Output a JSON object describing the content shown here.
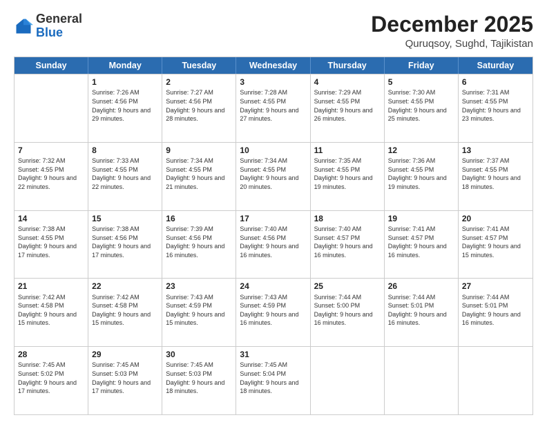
{
  "logo": {
    "general": "General",
    "blue": "Blue"
  },
  "title": "December 2025",
  "location": "Quruqsoy, Sughd, Tajikistan",
  "weekdays": [
    "Sunday",
    "Monday",
    "Tuesday",
    "Wednesday",
    "Thursday",
    "Friday",
    "Saturday"
  ],
  "rows": [
    [
      {
        "day": "",
        "sunrise": "",
        "sunset": "",
        "daylight": ""
      },
      {
        "day": "1",
        "sunrise": "Sunrise: 7:26 AM",
        "sunset": "Sunset: 4:56 PM",
        "daylight": "Daylight: 9 hours and 29 minutes."
      },
      {
        "day": "2",
        "sunrise": "Sunrise: 7:27 AM",
        "sunset": "Sunset: 4:56 PM",
        "daylight": "Daylight: 9 hours and 28 minutes."
      },
      {
        "day": "3",
        "sunrise": "Sunrise: 7:28 AM",
        "sunset": "Sunset: 4:55 PM",
        "daylight": "Daylight: 9 hours and 27 minutes."
      },
      {
        "day": "4",
        "sunrise": "Sunrise: 7:29 AM",
        "sunset": "Sunset: 4:55 PM",
        "daylight": "Daylight: 9 hours and 26 minutes."
      },
      {
        "day": "5",
        "sunrise": "Sunrise: 7:30 AM",
        "sunset": "Sunset: 4:55 PM",
        "daylight": "Daylight: 9 hours and 25 minutes."
      },
      {
        "day": "6",
        "sunrise": "Sunrise: 7:31 AM",
        "sunset": "Sunset: 4:55 PM",
        "daylight": "Daylight: 9 hours and 23 minutes."
      }
    ],
    [
      {
        "day": "7",
        "sunrise": "Sunrise: 7:32 AM",
        "sunset": "Sunset: 4:55 PM",
        "daylight": "Daylight: 9 hours and 22 minutes."
      },
      {
        "day": "8",
        "sunrise": "Sunrise: 7:33 AM",
        "sunset": "Sunset: 4:55 PM",
        "daylight": "Daylight: 9 hours and 22 minutes."
      },
      {
        "day": "9",
        "sunrise": "Sunrise: 7:34 AM",
        "sunset": "Sunset: 4:55 PM",
        "daylight": "Daylight: 9 hours and 21 minutes."
      },
      {
        "day": "10",
        "sunrise": "Sunrise: 7:34 AM",
        "sunset": "Sunset: 4:55 PM",
        "daylight": "Daylight: 9 hours and 20 minutes."
      },
      {
        "day": "11",
        "sunrise": "Sunrise: 7:35 AM",
        "sunset": "Sunset: 4:55 PM",
        "daylight": "Daylight: 9 hours and 19 minutes."
      },
      {
        "day": "12",
        "sunrise": "Sunrise: 7:36 AM",
        "sunset": "Sunset: 4:55 PM",
        "daylight": "Daylight: 9 hours and 19 minutes."
      },
      {
        "day": "13",
        "sunrise": "Sunrise: 7:37 AM",
        "sunset": "Sunset: 4:55 PM",
        "daylight": "Daylight: 9 hours and 18 minutes."
      }
    ],
    [
      {
        "day": "14",
        "sunrise": "Sunrise: 7:38 AM",
        "sunset": "Sunset: 4:55 PM",
        "daylight": "Daylight: 9 hours and 17 minutes."
      },
      {
        "day": "15",
        "sunrise": "Sunrise: 7:38 AM",
        "sunset": "Sunset: 4:56 PM",
        "daylight": "Daylight: 9 hours and 17 minutes."
      },
      {
        "day": "16",
        "sunrise": "Sunrise: 7:39 AM",
        "sunset": "Sunset: 4:56 PM",
        "daylight": "Daylight: 9 hours and 16 minutes."
      },
      {
        "day": "17",
        "sunrise": "Sunrise: 7:40 AM",
        "sunset": "Sunset: 4:56 PM",
        "daylight": "Daylight: 9 hours and 16 minutes."
      },
      {
        "day": "18",
        "sunrise": "Sunrise: 7:40 AM",
        "sunset": "Sunset: 4:57 PM",
        "daylight": "Daylight: 9 hours and 16 minutes."
      },
      {
        "day": "19",
        "sunrise": "Sunrise: 7:41 AM",
        "sunset": "Sunset: 4:57 PM",
        "daylight": "Daylight: 9 hours and 16 minutes."
      },
      {
        "day": "20",
        "sunrise": "Sunrise: 7:41 AM",
        "sunset": "Sunset: 4:57 PM",
        "daylight": "Daylight: 9 hours and 15 minutes."
      }
    ],
    [
      {
        "day": "21",
        "sunrise": "Sunrise: 7:42 AM",
        "sunset": "Sunset: 4:58 PM",
        "daylight": "Daylight: 9 hours and 15 minutes."
      },
      {
        "day": "22",
        "sunrise": "Sunrise: 7:42 AM",
        "sunset": "Sunset: 4:58 PM",
        "daylight": "Daylight: 9 hours and 15 minutes."
      },
      {
        "day": "23",
        "sunrise": "Sunrise: 7:43 AM",
        "sunset": "Sunset: 4:59 PM",
        "daylight": "Daylight: 9 hours and 15 minutes."
      },
      {
        "day": "24",
        "sunrise": "Sunrise: 7:43 AM",
        "sunset": "Sunset: 4:59 PM",
        "daylight": "Daylight: 9 hours and 16 minutes."
      },
      {
        "day": "25",
        "sunrise": "Sunrise: 7:44 AM",
        "sunset": "Sunset: 5:00 PM",
        "daylight": "Daylight: 9 hours and 16 minutes."
      },
      {
        "day": "26",
        "sunrise": "Sunrise: 7:44 AM",
        "sunset": "Sunset: 5:01 PM",
        "daylight": "Daylight: 9 hours and 16 minutes."
      },
      {
        "day": "27",
        "sunrise": "Sunrise: 7:44 AM",
        "sunset": "Sunset: 5:01 PM",
        "daylight": "Daylight: 9 hours and 16 minutes."
      }
    ],
    [
      {
        "day": "28",
        "sunrise": "Sunrise: 7:45 AM",
        "sunset": "Sunset: 5:02 PM",
        "daylight": "Daylight: 9 hours and 17 minutes."
      },
      {
        "day": "29",
        "sunrise": "Sunrise: 7:45 AM",
        "sunset": "Sunset: 5:03 PM",
        "daylight": "Daylight: 9 hours and 17 minutes."
      },
      {
        "day": "30",
        "sunrise": "Sunrise: 7:45 AM",
        "sunset": "Sunset: 5:03 PM",
        "daylight": "Daylight: 9 hours and 18 minutes."
      },
      {
        "day": "31",
        "sunrise": "Sunrise: 7:45 AM",
        "sunset": "Sunset: 5:04 PM",
        "daylight": "Daylight: 9 hours and 18 minutes."
      },
      {
        "day": "",
        "sunrise": "",
        "sunset": "",
        "daylight": ""
      },
      {
        "day": "",
        "sunrise": "",
        "sunset": "",
        "daylight": ""
      },
      {
        "day": "",
        "sunrise": "",
        "sunset": "",
        "daylight": ""
      }
    ]
  ]
}
